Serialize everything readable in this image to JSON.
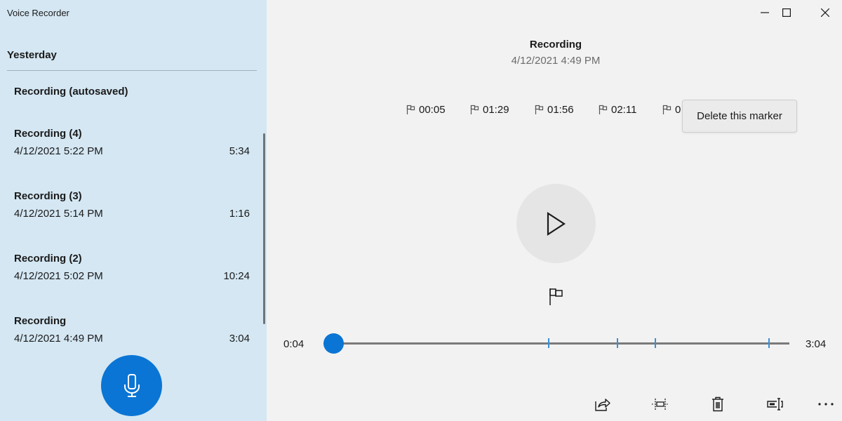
{
  "app": {
    "title": "Voice Recorder",
    "accent_color": "#0a75d4",
    "sidebar_color": "#d4e7f3"
  },
  "sidebar": {
    "group_header": "Yesterday",
    "recordings": [
      {
        "name": "Recording (autosaved)",
        "date": "",
        "duration": ""
      },
      {
        "name": "Recording (4)",
        "date": "4/12/2021 5:22 PM",
        "duration": "5:34"
      },
      {
        "name": "Recording (3)",
        "date": "4/12/2021 5:14 PM",
        "duration": "1:16"
      },
      {
        "name": "Recording (2)",
        "date": "4/12/2021 5:02 PM",
        "duration": "10:24"
      },
      {
        "name": "Recording",
        "date": "4/12/2021 4:49 PM",
        "duration": "3:04"
      }
    ],
    "record_button_icon": "microphone-icon"
  },
  "window_controls": {
    "minimize_icon": "minimize-icon",
    "maximize_icon": "maximize-icon",
    "close_icon": "close-icon"
  },
  "player": {
    "title": "Recording",
    "subtitle": "4/12/2021 4:49 PM",
    "markers": [
      {
        "label": "00:05",
        "seconds": 5
      },
      {
        "label": "01:29",
        "seconds": 89
      },
      {
        "label": "01:56",
        "seconds": 116
      },
      {
        "label": "02:11",
        "seconds": 131
      },
      {
        "label": "0",
        "seconds": 176
      }
    ],
    "tooltip": "Delete this marker",
    "elapsed": "0:04",
    "total": "3:04",
    "position_seconds": 4,
    "total_seconds": 184,
    "play_icon": "play-icon",
    "add_marker_icon": "flag-icon"
  },
  "command_bar": [
    {
      "name": "share-button",
      "icon": "share-icon"
    },
    {
      "name": "trim-button",
      "icon": "trim-icon"
    },
    {
      "name": "delete-button",
      "icon": "trash-icon"
    },
    {
      "name": "rename-button",
      "icon": "rename-icon"
    },
    {
      "name": "more-button",
      "icon": "more-icon"
    }
  ]
}
